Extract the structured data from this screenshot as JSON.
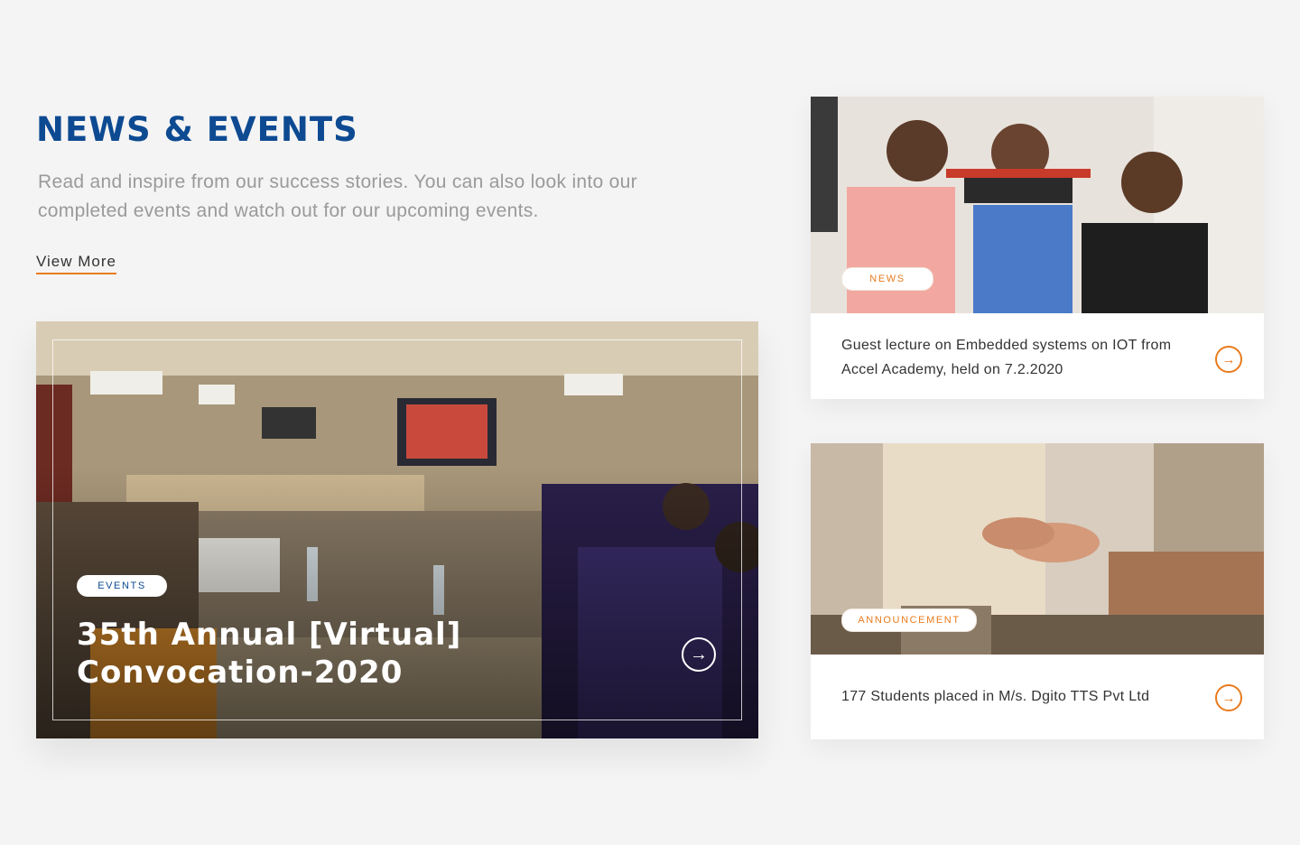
{
  "section": {
    "title": "NEWS & EVENTS",
    "description": "Read and inspire from our success stories. You can also look into our completed events and watch out for our upcoming events.",
    "view_more": "View More"
  },
  "featured": {
    "tag": "EVENTS",
    "title": "35th Annual [Virtual] Convocation-2020",
    "arrow_icon": "arrow-right-circle-icon"
  },
  "cards": [
    {
      "tag": "NEWS",
      "text": "Guest lecture on Embedded systems on IOT from Accel Academy, held on 7.2.2020",
      "arrow_icon": "arrow-right-circle-icon"
    },
    {
      "tag": "ANNOUNCEMENT",
      "text": "177 Students placed in M/s. Dgito TTS Pvt Ltd",
      "arrow_icon": "arrow-right-circle-icon"
    }
  ],
  "colors": {
    "brand_blue": "#0d4a92",
    "accent_orange": "#e87b1e",
    "background": "#f4f4f4"
  }
}
